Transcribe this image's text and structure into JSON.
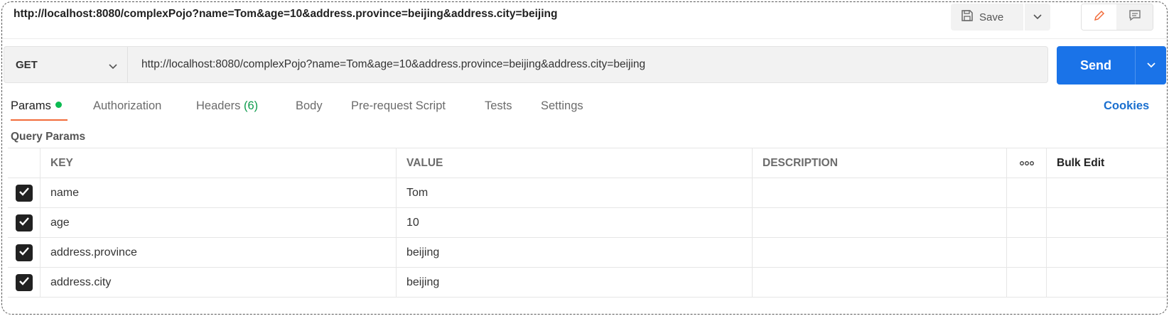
{
  "header": {
    "url_title": "http://localhost:8080/complexPojo?name=Tom&age=10&address.province=beijing&address.city=beijing",
    "save_label": "Save",
    "icons": [
      "save-icon",
      "chevron-down-icon",
      "pencil-icon",
      "comment-icon"
    ]
  },
  "request": {
    "method": "GET",
    "url": "http://localhost:8080/complexPojo?name=Tom&age=10&address.province=beijing&address.city=beijing",
    "send_label": "Send",
    "send_color": "#1a73e8"
  },
  "tabs": {
    "params": "Params",
    "authorization": "Authorization",
    "headers": "Headers",
    "headers_count": "(6)",
    "body": "Body",
    "prerequest": "Pre-request Script",
    "tests": "Tests",
    "settings": "Settings",
    "cookies": "Cookies",
    "active_underline_color": "#f26b3a"
  },
  "query_params": {
    "title": "Query Params",
    "columns": {
      "key": "KEY",
      "value": "VALUE",
      "description": "DESCRIPTION",
      "more": "ooo",
      "bulk_edit": "Bulk Edit"
    },
    "rows": [
      {
        "checked": true,
        "key": "name",
        "value": "Tom",
        "description": ""
      },
      {
        "checked": true,
        "key": "age",
        "value": "10",
        "description": ""
      },
      {
        "checked": true,
        "key": "address.province",
        "value": "beijing",
        "description": ""
      },
      {
        "checked": true,
        "key": "address.city",
        "value": "beijing",
        "description": ""
      }
    ]
  }
}
